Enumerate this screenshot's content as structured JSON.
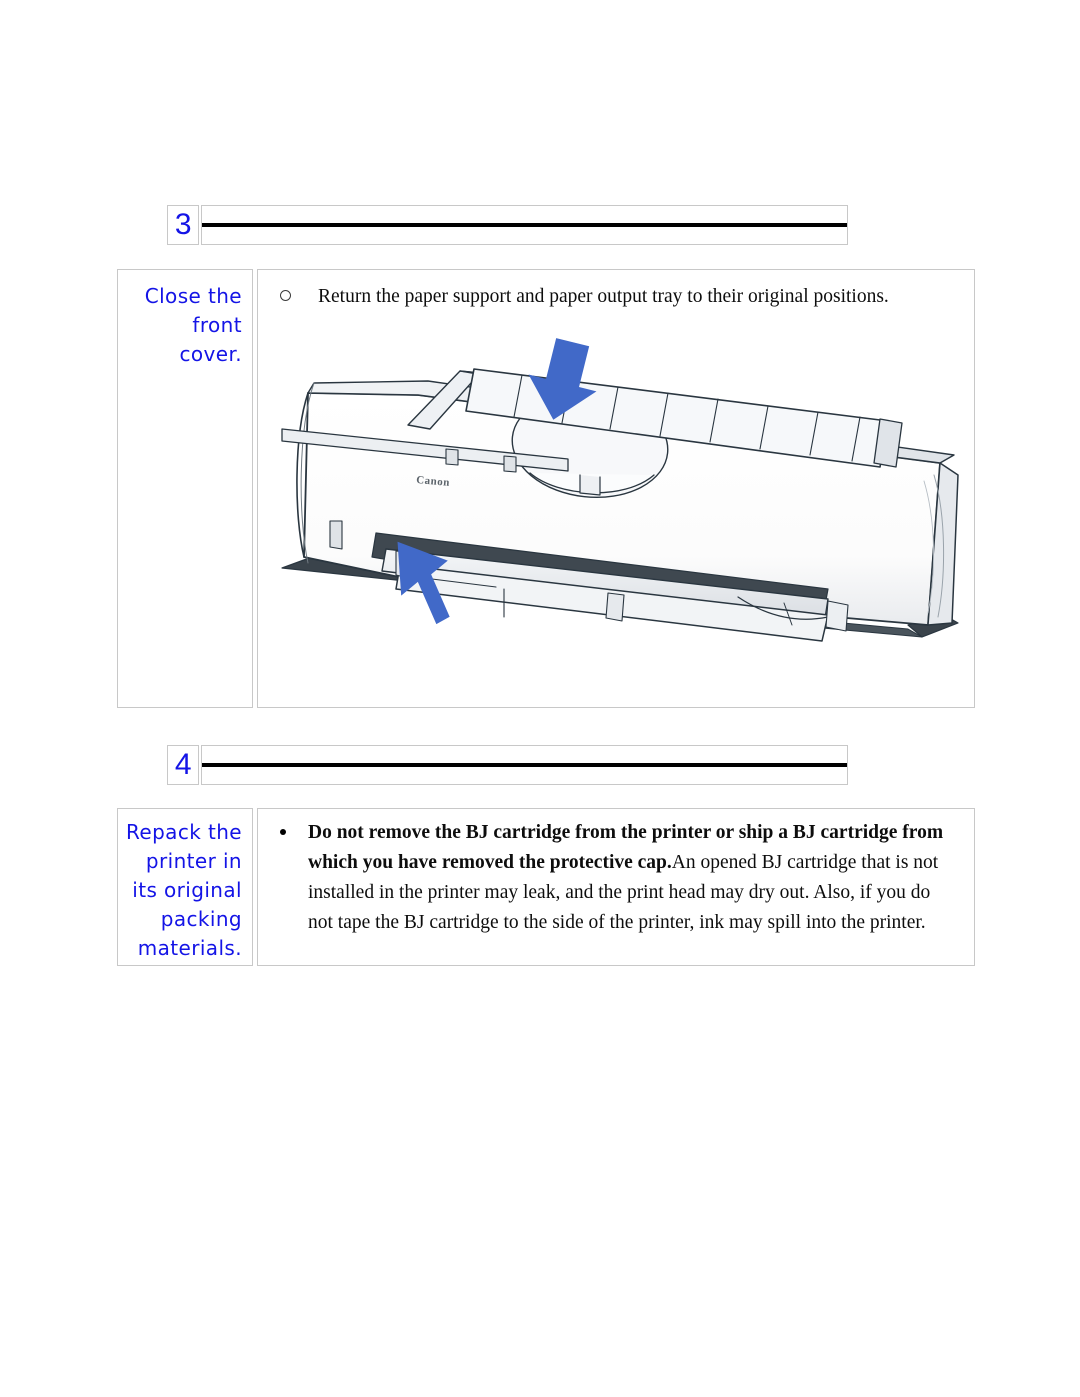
{
  "page": {
    "background": "#ffffff",
    "accent_blue": "#1414e6",
    "arrow_blue": "#4169c8",
    "rule_color": "#000000",
    "border_color": "#c8c8c8"
  },
  "steps": [
    {
      "number": "3",
      "label_lines": [
        "Close the",
        "front cover."
      ],
      "bullet_style": "hollow",
      "body_text": "Return the paper support and paper output tray to their original positions.",
      "has_illustration": true,
      "illustration": {
        "name": "canon-bj-printer",
        "brand_label": "Canon",
        "arrows": [
          {
            "name": "down-arrow",
            "direction": "down",
            "target": "paper-support"
          },
          {
            "name": "up-right-arrow",
            "direction": "up-right",
            "target": "front-cover"
          }
        ]
      }
    },
    {
      "number": "4",
      "label_lines": [
        "Repack the",
        "printer in",
        "its original",
        "packing",
        "materials."
      ],
      "bullet_style": "solid",
      "body_bold": "Do not remove the BJ cartridge from the printer or ship a BJ cartridge from which you have removed the protective cap.",
      "body_rest": "An opened BJ cartridge that is not installed in the printer may leak, and the print head may dry out. Also, if you do not tape the BJ cartridge to the side of the printer, ink may spill into the printer.",
      "has_illustration": false
    }
  ]
}
